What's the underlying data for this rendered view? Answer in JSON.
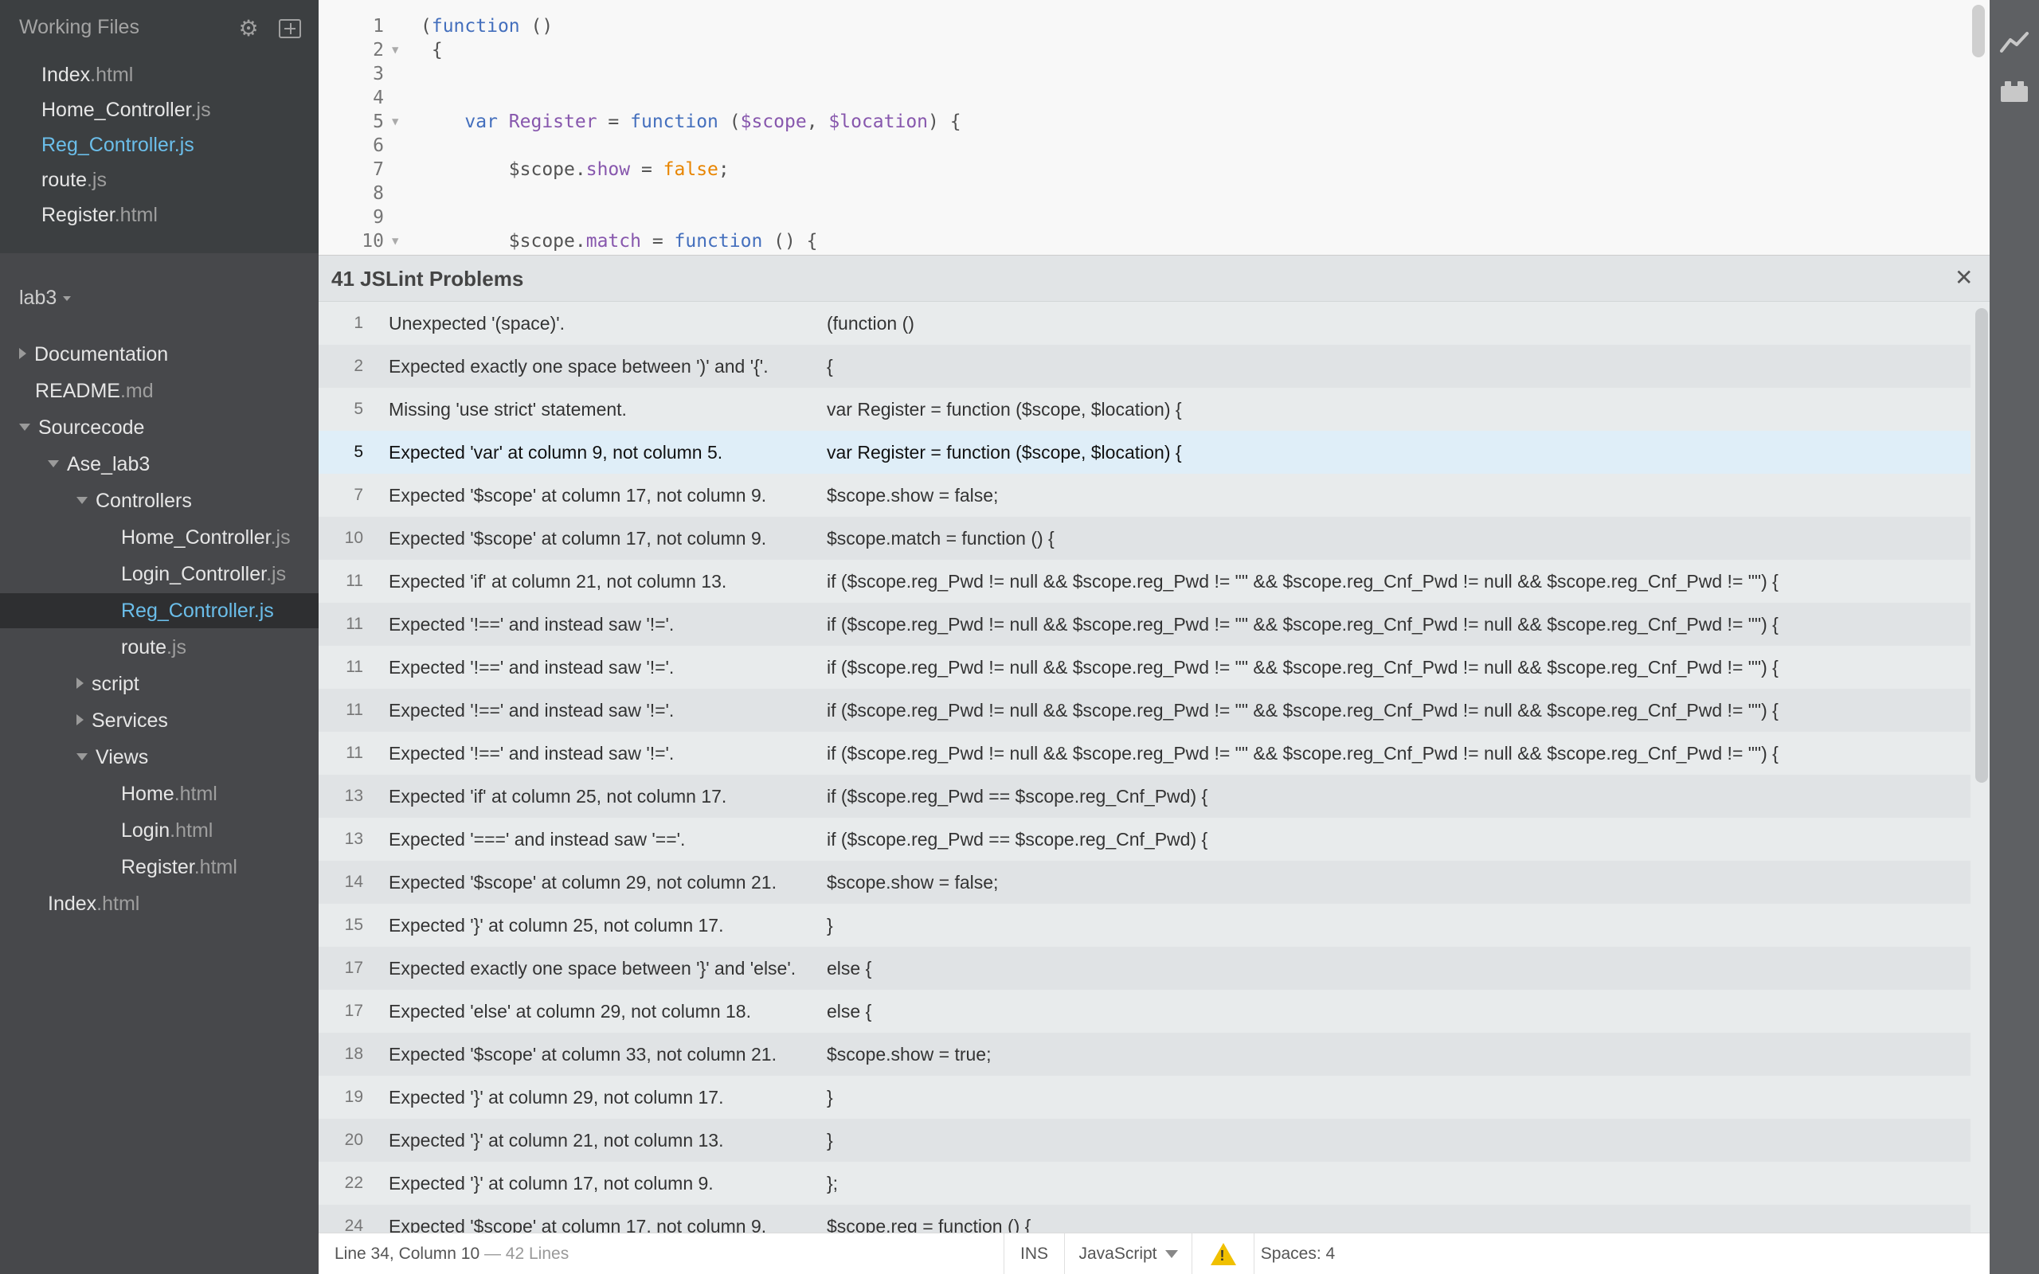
{
  "working_files": {
    "title": "Working Files",
    "items": [
      {
        "name": "Index",
        "ext": ".html",
        "active": false
      },
      {
        "name": "Home_Controller",
        "ext": ".js",
        "active": false
      },
      {
        "name": "Reg_Controller",
        "ext": ".js",
        "active": true
      },
      {
        "name": "route",
        "ext": ".js",
        "active": false
      },
      {
        "name": "Register",
        "ext": ".html",
        "active": false
      }
    ]
  },
  "project": {
    "name": "lab3"
  },
  "tree": [
    {
      "label": "Documentation",
      "ext": "",
      "kind": "folder-closed",
      "indent": 0
    },
    {
      "label": "README",
      "ext": ".md",
      "kind": "file",
      "indent": 0
    },
    {
      "label": "Sourcecode",
      "ext": "",
      "kind": "folder-open",
      "indent": 0
    },
    {
      "label": "Ase_lab3",
      "ext": "",
      "kind": "folder-open",
      "indent": 1
    },
    {
      "label": "Controllers",
      "ext": "",
      "kind": "folder-open",
      "indent": 2
    },
    {
      "label": "Home_Controller",
      "ext": ".js",
      "kind": "file",
      "indent": 3
    },
    {
      "label": "Login_Controller",
      "ext": ".js",
      "kind": "file",
      "indent": 3
    },
    {
      "label": "Reg_Controller",
      "ext": ".js",
      "kind": "file",
      "indent": 3,
      "selected": true
    },
    {
      "label": "route",
      "ext": ".js",
      "kind": "file",
      "indent": 3
    },
    {
      "label": "script",
      "ext": "",
      "kind": "folder-closed",
      "indent": 2
    },
    {
      "label": "Services",
      "ext": "",
      "kind": "folder-closed",
      "indent": 2
    },
    {
      "label": "Views",
      "ext": "",
      "kind": "folder-open",
      "indent": 2
    },
    {
      "label": "Home",
      "ext": ".html",
      "kind": "file",
      "indent": 3
    },
    {
      "label": "Login",
      "ext": ".html",
      "kind": "file",
      "indent": 3
    },
    {
      "label": "Register",
      "ext": ".html",
      "kind": "file",
      "indent": 3
    },
    {
      "label": "Index",
      "ext": ".html",
      "kind": "file",
      "indent": 1
    }
  ],
  "editor": {
    "lines": [
      {
        "n": "1",
        "fold": false,
        "tokens": [
          [
            "p",
            "("
          ],
          [
            "kw",
            "function"
          ],
          [
            "p",
            " ()"
          ]
        ]
      },
      {
        "n": "2",
        "fold": true,
        "tokens": [
          [
            "p",
            " {"
          ]
        ]
      },
      {
        "n": "3",
        "fold": false,
        "tokens": []
      },
      {
        "n": "4",
        "fold": false,
        "tokens": []
      },
      {
        "n": "5",
        "fold": true,
        "tokens": [
          [
            "p",
            "    "
          ],
          [
            "kw",
            "var"
          ],
          [
            "p",
            " "
          ],
          [
            "var",
            "Register"
          ],
          [
            "p",
            " = "
          ],
          [
            "kw",
            "function"
          ],
          [
            "p",
            " ("
          ],
          [
            "var",
            "$scope"
          ],
          [
            "p",
            ", "
          ],
          [
            "var",
            "$location"
          ],
          [
            "p",
            ") {"
          ]
        ]
      },
      {
        "n": "6",
        "fold": false,
        "tokens": []
      },
      {
        "n": "7",
        "fold": false,
        "tokens": [
          [
            "p",
            "        $scope."
          ],
          [
            "prop",
            "show"
          ],
          [
            "p",
            " = "
          ],
          [
            "lit",
            "false"
          ],
          [
            "p",
            ";"
          ]
        ]
      },
      {
        "n": "8",
        "fold": false,
        "tokens": []
      },
      {
        "n": "9",
        "fold": false,
        "tokens": []
      },
      {
        "n": "10",
        "fold": true,
        "tokens": [
          [
            "p",
            "        $scope."
          ],
          [
            "prop",
            "match"
          ],
          [
            "p",
            " = "
          ],
          [
            "kw",
            "function"
          ],
          [
            "p",
            " () {"
          ]
        ]
      }
    ]
  },
  "problems": {
    "title": "41 JSLint Problems",
    "close_glyph": "✕",
    "rows": [
      {
        "line": "1",
        "msg": "Unexpected '(space)'.",
        "code": "(function ()"
      },
      {
        "line": "2",
        "msg": "Expected exactly one space between ')' and '{'.",
        "code": "{"
      },
      {
        "line": "5",
        "msg": "Missing 'use strict' statement.",
        "code": "var Register = function ($scope, $location) {"
      },
      {
        "line": "5",
        "msg": "Expected 'var' at column 9, not column 5.",
        "code": "var Register = function ($scope, $location) {",
        "highlight": true
      },
      {
        "line": "7",
        "msg": "Expected '$scope' at column 17, not column 9.",
        "code": "$scope.show = false;"
      },
      {
        "line": "10",
        "msg": "Expected '$scope' at column 17, not column 9.",
        "code": "$scope.match = function () {"
      },
      {
        "line": "11",
        "msg": "Expected 'if' at column 21, not column 13.",
        "code": "if ($scope.reg_Pwd != null && $scope.reg_Pwd != \"\" && $scope.reg_Cnf_Pwd != null && $scope.reg_Cnf_Pwd != \"\") {"
      },
      {
        "line": "11",
        "msg": "Expected '!==' and instead saw '!='.",
        "code": "if ($scope.reg_Pwd != null && $scope.reg_Pwd != \"\" && $scope.reg_Cnf_Pwd != null && $scope.reg_Cnf_Pwd != \"\") {"
      },
      {
        "line": "11",
        "msg": "Expected '!==' and instead saw '!='.",
        "code": "if ($scope.reg_Pwd != null && $scope.reg_Pwd != \"\" && $scope.reg_Cnf_Pwd != null && $scope.reg_Cnf_Pwd != \"\") {"
      },
      {
        "line": "11",
        "msg": "Expected '!==' and instead saw '!='.",
        "code": "if ($scope.reg_Pwd != null && $scope.reg_Pwd != \"\" && $scope.reg_Cnf_Pwd != null && $scope.reg_Cnf_Pwd != \"\") {"
      },
      {
        "line": "11",
        "msg": "Expected '!==' and instead saw '!='.",
        "code": "if ($scope.reg_Pwd != null && $scope.reg_Pwd != \"\" && $scope.reg_Cnf_Pwd != null && $scope.reg_Cnf_Pwd != \"\") {"
      },
      {
        "line": "13",
        "msg": "Expected 'if' at column 25, not column 17.",
        "code": "if ($scope.reg_Pwd == $scope.reg_Cnf_Pwd) {"
      },
      {
        "line": "13",
        "msg": "Expected '===' and instead saw '=='.",
        "code": "if ($scope.reg_Pwd == $scope.reg_Cnf_Pwd) {"
      },
      {
        "line": "14",
        "msg": "Expected '$scope' at column 29, not column 21.",
        "code": "$scope.show = false;"
      },
      {
        "line": "15",
        "msg": "Expected '}' at column 25, not column 17.",
        "code": "}"
      },
      {
        "line": "17",
        "msg": "Expected exactly one space between '}' and 'else'.",
        "code": "else {"
      },
      {
        "line": "17",
        "msg": "Expected 'else' at column 29, not column 18.",
        "code": "else {"
      },
      {
        "line": "18",
        "msg": "Expected '$scope' at column 33, not column 21.",
        "code": "$scope.show = true;"
      },
      {
        "line": "19",
        "msg": "Expected '}' at column 29, not column 17.",
        "code": "}"
      },
      {
        "line": "20",
        "msg": "Expected '}' at column 21, not column 13.",
        "code": "}"
      },
      {
        "line": "22",
        "msg": "Expected '}' at column 17, not column 9.",
        "code": "};"
      },
      {
        "line": "24",
        "msg": "Expected '$scope' at column 17, not column 9.",
        "code": "$scope.reg = function () {"
      }
    ]
  },
  "statusbar": {
    "position": "Line 34, Column 10",
    "lines": " — 42 Lines",
    "mode": "INS",
    "language": "JavaScript",
    "spaces": "Spaces:  4"
  },
  "toolbar": {
    "icons": [
      "live-preview-icon",
      "extension-manager-icon"
    ]
  },
  "colors": {
    "accent": "#6bbeea",
    "keyword": "#446fbd",
    "variable": "#8757ad",
    "literal": "#e88501",
    "warning": "#f0c000"
  }
}
